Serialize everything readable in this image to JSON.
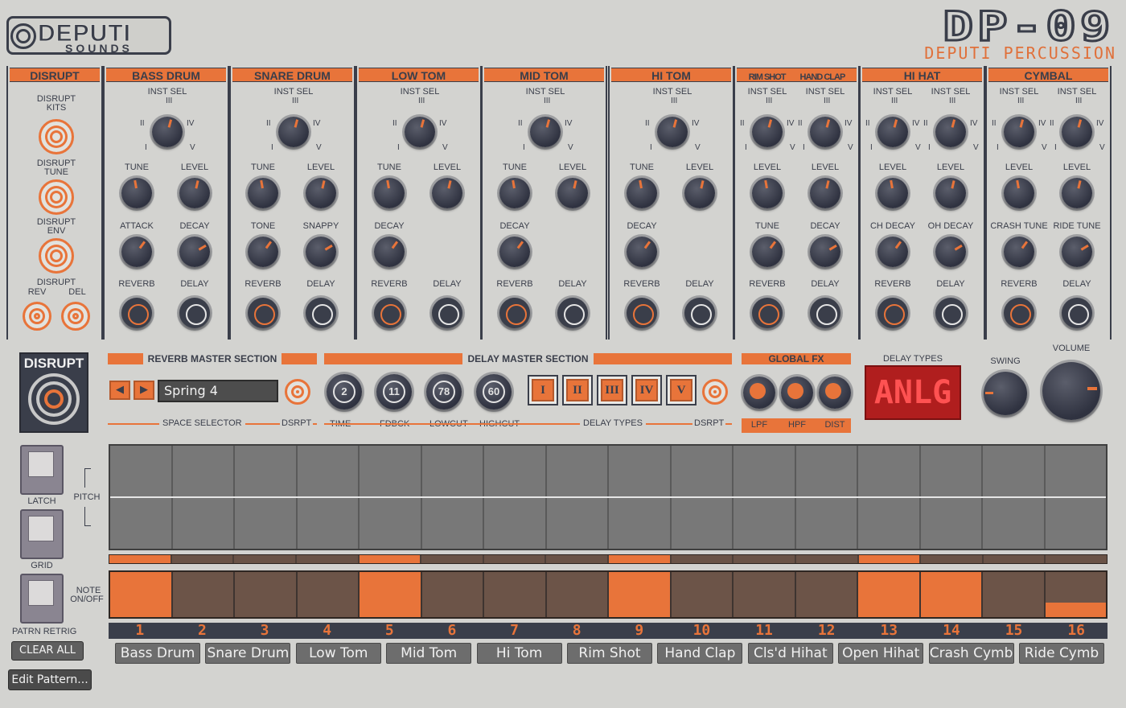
{
  "header": {
    "brand_top": "DEPUTI",
    "brand_bottom": "SOUNDS",
    "model": "DP-09",
    "subtitle": "DEPUTI PERCUSSION"
  },
  "disrupt_strip": {
    "title": "DISRUPT",
    "labels": [
      "DISRUPT KITS",
      "DISRUPT TUNE",
      "DISRUPT ENV",
      "DISRUPT",
      "REV",
      "DEL"
    ]
  },
  "roman": [
    "I",
    "II",
    "III",
    "IV",
    "V"
  ],
  "inst_sel": "INST SEL",
  "channels": [
    {
      "title": "BASS DRUM",
      "labels": [
        "TUNE",
        "LEVEL",
        "ATTACK",
        "DECAY",
        "REVERB",
        "DELAY"
      ]
    },
    {
      "title": "SNARE DRUM",
      "labels": [
        "TUNE",
        "LEVEL",
        "TONE",
        "SNAPPY",
        "REVERB",
        "DELAY"
      ]
    },
    {
      "title": "LOW TOM",
      "labels": [
        "TUNE",
        "LEVEL",
        "DECAY",
        "REVERB",
        "DELAY"
      ]
    },
    {
      "title": "MID TOM",
      "labels": [
        "TUNE",
        "LEVEL",
        "DECAY",
        "REVERB",
        "DELAY"
      ]
    },
    {
      "title": "HI TOM",
      "labels": [
        "TUNE",
        "LEVEL",
        "DECAY",
        "REVERB",
        "DELAY"
      ]
    },
    {
      "title_a": "RIM SHOT",
      "title_b": "HAND CLAP",
      "labels": [
        "LEVEL",
        "LEVEL",
        "TUNE",
        "DECAY",
        "REVERB",
        "DELAY"
      ]
    },
    {
      "title": "HI HAT",
      "labels": [
        "LEVEL",
        "LEVEL",
        "CH DECAY",
        "OH DECAY",
        "REVERB",
        "DELAY"
      ]
    },
    {
      "title": "CYMBAL",
      "labels": [
        "LEVEL",
        "LEVEL",
        "CRASH TUNE",
        "RIDE TUNE",
        "REVERB",
        "DELAY"
      ]
    }
  ],
  "master": {
    "disrupt_title": "DISRUPT",
    "reverb_section": "REVERB MASTER SECTION",
    "space_selector": "SPACE SELECTOR",
    "dsrpt": "DSRPT",
    "space_value": "Spring 4",
    "prev_arrow": "◀",
    "next_arrow": "▶",
    "delay_section": "DELAY MASTER SECTION",
    "delay_knobs": [
      {
        "label": "TIME",
        "value": "2"
      },
      {
        "label": "FDBCK",
        "value": "11"
      },
      {
        "label": "LOWCUT",
        "value": "78"
      },
      {
        "label": "HIGHCUT",
        "value": "60"
      }
    ],
    "delay_types_label": "DELAY TYPES",
    "delay_buttons": [
      "I",
      "II",
      "III",
      "IV",
      "V"
    ],
    "global_fx": "GLOBAL FX",
    "fx_labels": [
      "LPF",
      "HPF",
      "DIST"
    ],
    "delay_types_title": "DELAY TYPES",
    "lcd": "ANLG",
    "swing": "SWING",
    "volume": "VOLUME"
  },
  "sequencer": {
    "latch": "LATCH",
    "grid": "GRID",
    "pitch": "PITCH",
    "note_onoff_1": "NOTE",
    "note_onoff_2": "ON/OFF",
    "patrn_retrig": "PATRN RETRIG",
    "clear_all": "CLEAR ALL",
    "edit_pattern": "Edit Pattern...",
    "accent_on": [
      1,
      5,
      9,
      13
    ],
    "notes_on": [
      1,
      5,
      9,
      13,
      14
    ],
    "notes_half": [
      16
    ],
    "steps": [
      "1",
      "2",
      "3",
      "4",
      "5",
      "6",
      "7",
      "8",
      "9",
      "10",
      "11",
      "12",
      "13",
      "14",
      "15",
      "16"
    ],
    "instruments": [
      "Bass Drum",
      "Snare Drum",
      "Low Tom",
      "Mid Tom",
      "Hi Tom",
      "Rim Shot",
      "Hand Clap",
      "Cls'd Hihat",
      "Open Hihat",
      "Crash Cymb",
      "Ride Cymb"
    ]
  },
  "colors": {
    "accent": "#e8743a",
    "panel": "#d3d3d0",
    "knob": "#2f3240",
    "lcd": "#b01e1e"
  }
}
